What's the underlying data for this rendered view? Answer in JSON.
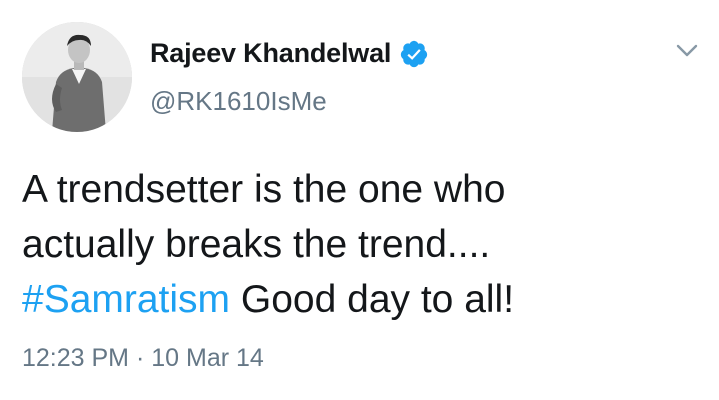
{
  "author": {
    "name": "Rajeev Khandelwal",
    "handle": "@RK1610IsMe",
    "verified": true,
    "avatar_icon": "profile-photo"
  },
  "tweet": {
    "text_line1": "A trendsetter is the one who",
    "text_line2": "actually breaks the trend....",
    "hashtag": "#Samratism",
    "text_after_hashtag": " Good day to all!"
  },
  "meta": {
    "time": "12:23 PM",
    "separator": " · ",
    "date": "10 Mar 14"
  },
  "colors": {
    "accent": "#1da1f2",
    "text": "#14171a",
    "muted": "#657786"
  },
  "icons": {
    "verified": "verified-badge-icon",
    "menu": "chevron-down-icon"
  }
}
